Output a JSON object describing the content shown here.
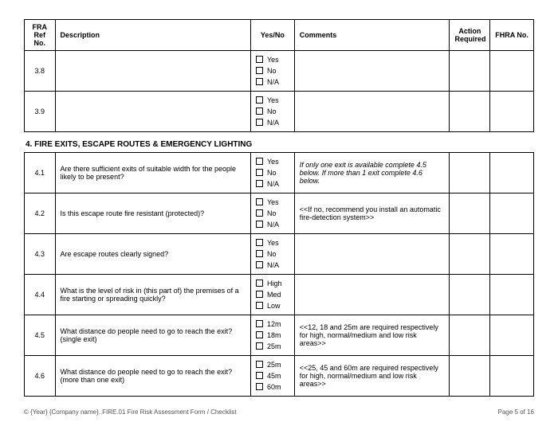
{
  "headers": {
    "ref": "FRA Ref No.",
    "description": "Description",
    "yesno": "Yes/No",
    "comments": "Comments",
    "action": "Action Required",
    "fhra": "FHRA No."
  },
  "options": {
    "yes": "Yes",
    "no": "No",
    "na": "N/A",
    "high": "High",
    "med": "Med",
    "low": "Low",
    "d12": "12m",
    "d18": "18m",
    "d25": "25m",
    "d45": "45m",
    "d60": "60m"
  },
  "section3": {
    "rows": [
      {
        "ref": "3.8",
        "desc": "",
        "comment": ""
      },
      {
        "ref": "3.9",
        "desc": "",
        "comment": ""
      }
    ]
  },
  "section4": {
    "title": "4. FIRE EXITS, ESCAPE ROUTES & EMERGENCY LIGHTING",
    "rows": [
      {
        "ref": "4.1",
        "desc": "Are there sufficient exits of suitable width for the people likely to be present?",
        "comment": "If only one exit is available complete 4.5 below. If more than 1 exit complete 4.6 below."
      },
      {
        "ref": "4.2",
        "desc": "Is this escape route fire resistant (protected)?",
        "comment": "<<If no, recommend you install an automatic fire-detection system>>"
      },
      {
        "ref": "4.3",
        "desc": "Are escape routes clearly signed?",
        "comment": ""
      },
      {
        "ref": "4.4",
        "desc": "What is the level of risk in (this part of) the premises of a fire starting or spreading quickly?",
        "comment": ""
      },
      {
        "ref": "4.5",
        "desc": "What distance do people need to go to reach the exit? (single exit)",
        "comment": "<<12, 18 and 25m are required respectively for high, normal/medium and low risk areas>>"
      },
      {
        "ref": "4.6",
        "desc": "What distance do people need to go to reach the exit? (more than one exit)",
        "comment": "<<25, 45 and 60m are required respectively for high, normal/medium and low risk areas>>"
      }
    ]
  },
  "footer": {
    "left": "© {Year} {Company name}..FIRE.01 Fire Risk Assessment Form / Checklist",
    "right": "Page 5 of 16"
  },
  "chart_data": {
    "type": "table",
    "page": "5 of 16",
    "columns": [
      "FRA Ref No.",
      "Description",
      "Yes/No",
      "Comments",
      "Action Required",
      "FHRA No."
    ],
    "rows": [
      {
        "ref": "3.8",
        "description": "",
        "options": [
          "Yes",
          "No",
          "N/A"
        ],
        "comments": ""
      },
      {
        "ref": "3.9",
        "description": "",
        "options": [
          "Yes",
          "No",
          "N/A"
        ],
        "comments": ""
      },
      {
        "ref": "4.1",
        "description": "Are there sufficient exits of suitable width for the people likely to be present?",
        "options": [
          "Yes",
          "No",
          "N/A"
        ],
        "comments": "If only one exit is available complete 4.5 below. If more than 1 exit complete 4.6 below."
      },
      {
        "ref": "4.2",
        "description": "Is this escape route fire resistant (protected)?",
        "options": [
          "Yes",
          "No",
          "N/A"
        ],
        "comments": "<<If no, recommend you install an automatic fire-detection system>>"
      },
      {
        "ref": "4.3",
        "description": "Are escape routes clearly signed?",
        "options": [
          "Yes",
          "No",
          "N/A"
        ],
        "comments": ""
      },
      {
        "ref": "4.4",
        "description": "What is the level of risk in (this part of) the premises of a fire starting or spreading quickly?",
        "options": [
          "High",
          "Med",
          "Low"
        ],
        "comments": ""
      },
      {
        "ref": "4.5",
        "description": "What distance do people need to go to reach the exit? (single exit)",
        "options": [
          "12m",
          "18m",
          "25m"
        ],
        "comments": "<<12, 18 and 25m are required respectively for high, normal/medium and low risk areas>>"
      },
      {
        "ref": "4.6",
        "description": "What distance do people need to go to reach the exit? (more than one exit)",
        "options": [
          "25m",
          "45m",
          "60m"
        ],
        "comments": "<<25, 45 and 60m are required respectively for high, normal/medium and low risk areas>>"
      }
    ]
  }
}
